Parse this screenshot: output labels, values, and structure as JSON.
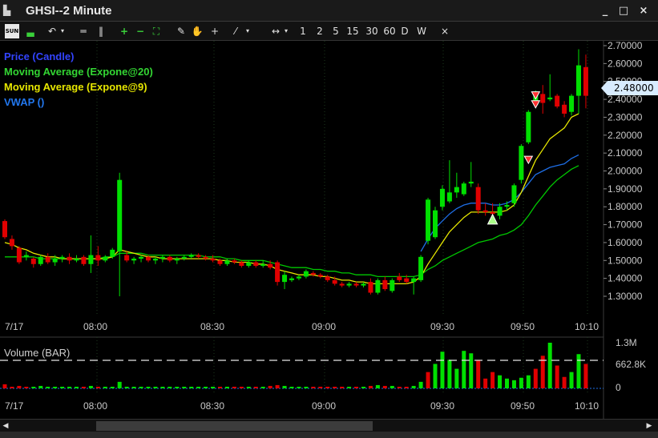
{
  "window": {
    "title": "GHSI--2 Minute",
    "minimize": "_",
    "maximize": "□",
    "close": "×"
  },
  "toolbar": {
    "sun_label": "SUN",
    "interval_1": "1",
    "interval_2": "2",
    "interval_5": "5",
    "interval_15": "15",
    "interval_30": "30",
    "interval_60": "60",
    "interval_d": "D",
    "interval_w": "W",
    "clear": "×"
  },
  "legend": {
    "price": "Price (Candle)",
    "ma20": "Moving Average (Expone@20)",
    "ma9": "Moving Average (Expone@9)",
    "vwap": "VWAP ()"
  },
  "price_tag": "2.48000",
  "volume": {
    "label": "Volume (BAR)",
    "ticks": [
      "1.3M",
      "662.8K",
      "0"
    ]
  },
  "colors": {
    "up": "#00e000",
    "down": "#e00000",
    "ma20": "#00c800",
    "ma9": "#e6e600",
    "vwap": "#1e6ee6",
    "grid": "#1e3a1e"
  },
  "chart_data": {
    "type": "candlestick",
    "y_ticks": [
      "2.70000",
      "2.60000",
      "2.50000",
      "2.40000",
      "2.30000",
      "2.20000",
      "2.10000",
      "2.00000",
      "1.90000",
      "1.80000",
      "1.70000",
      "1.60000",
      "1.50000",
      "1.40000",
      "1.30000"
    ],
    "x_ticks": [
      "7/17",
      "08:00",
      "08:30",
      "09:00",
      "09:30",
      "09:50",
      "10:10"
    ],
    "candles": [
      {
        "o": 1.72,
        "h": 1.73,
        "l": 1.62,
        "c": 1.63
      },
      {
        "o": 1.62,
        "h": 1.64,
        "l": 1.56,
        "c": 1.58
      },
      {
        "o": 1.57,
        "h": 1.58,
        "l": 1.48,
        "c": 1.49
      },
      {
        "o": 1.52,
        "h": 1.55,
        "l": 1.5,
        "c": 1.53
      },
      {
        "o": 1.51,
        "h": 1.52,
        "l": 1.46,
        "c": 1.48
      },
      {
        "o": 1.48,
        "h": 1.53,
        "l": 1.47,
        "c": 1.52
      },
      {
        "o": 1.52,
        "h": 1.54,
        "l": 1.48,
        "c": 1.49
      },
      {
        "o": 1.49,
        "h": 1.53,
        "l": 1.47,
        "c": 1.51
      },
      {
        "o": 1.51,
        "h": 1.53,
        "l": 1.49,
        "c": 1.52
      },
      {
        "o": 1.52,
        "h": 1.54,
        "l": 1.48,
        "c": 1.5
      },
      {
        "o": 1.5,
        "h": 1.53,
        "l": 1.49,
        "c": 1.51
      },
      {
        "o": 1.52,
        "h": 1.53,
        "l": 1.47,
        "c": 1.48
      },
      {
        "o": 1.48,
        "h": 1.64,
        "l": 1.43,
        "c": 1.53
      },
      {
        "o": 1.53,
        "h": 1.58,
        "l": 1.47,
        "c": 1.5
      },
      {
        "o": 1.5,
        "h": 1.53,
        "l": 1.49,
        "c": 1.52
      },
      {
        "o": 1.52,
        "h": 1.57,
        "l": 1.51,
        "c": 1.56
      },
      {
        "o": 1.55,
        "h": 1.99,
        "l": 1.3,
        "c": 1.95
      },
      {
        "o": 1.53,
        "h": 1.55,
        "l": 1.49,
        "c": 1.5
      },
      {
        "o": 1.5,
        "h": 1.52,
        "l": 1.48,
        "c": 1.51
      },
      {
        "o": 1.51,
        "h": 1.53,
        "l": 1.49,
        "c": 1.52
      },
      {
        "o": 1.52,
        "h": 1.53,
        "l": 1.49,
        "c": 1.5
      },
      {
        "o": 1.5,
        "h": 1.52,
        "l": 1.48,
        "c": 1.51
      },
      {
        "o": 1.51,
        "h": 1.53,
        "l": 1.49,
        "c": 1.52
      },
      {
        "o": 1.52,
        "h": 1.53,
        "l": 1.49,
        "c": 1.5
      },
      {
        "o": 1.5,
        "h": 1.52,
        "l": 1.48,
        "c": 1.51
      },
      {
        "o": 1.51,
        "h": 1.53,
        "l": 1.5,
        "c": 1.52
      },
      {
        "o": 1.52,
        "h": 1.54,
        "l": 1.51,
        "c": 1.53
      },
      {
        "o": 1.53,
        "h": 1.54,
        "l": 1.51,
        "c": 1.52
      },
      {
        "o": 1.52,
        "h": 1.53,
        "l": 1.5,
        "c": 1.51
      },
      {
        "o": 1.51,
        "h": 1.53,
        "l": 1.49,
        "c": 1.5
      },
      {
        "o": 1.5,
        "h": 1.51,
        "l": 1.47,
        "c": 1.48
      },
      {
        "o": 1.48,
        "h": 1.51,
        "l": 1.47,
        "c": 1.5
      },
      {
        "o": 1.5,
        "h": 1.51,
        "l": 1.48,
        "c": 1.49
      },
      {
        "o": 1.49,
        "h": 1.5,
        "l": 1.46,
        "c": 1.47
      },
      {
        "o": 1.47,
        "h": 1.5,
        "l": 1.46,
        "c": 1.49
      },
      {
        "o": 1.49,
        "h": 1.5,
        "l": 1.46,
        "c": 1.47
      },
      {
        "o": 1.47,
        "h": 1.5,
        "l": 1.46,
        "c": 1.48
      },
      {
        "o": 1.48,
        "h": 1.5,
        "l": 1.45,
        "c": 1.46
      },
      {
        "o": 1.49,
        "h": 1.5,
        "l": 1.36,
        "c": 1.38
      },
      {
        "o": 1.38,
        "h": 1.44,
        "l": 1.34,
        "c": 1.42
      },
      {
        "o": 1.39,
        "h": 1.41,
        "l": 1.38,
        "c": 1.4
      },
      {
        "o": 1.4,
        "h": 1.42,
        "l": 1.39,
        "c": 1.41
      },
      {
        "o": 1.41,
        "h": 1.45,
        "l": 1.4,
        "c": 1.44
      },
      {
        "o": 1.43,
        "h": 1.44,
        "l": 1.41,
        "c": 1.42
      },
      {
        "o": 1.42,
        "h": 1.43,
        "l": 1.4,
        "c": 1.41
      },
      {
        "o": 1.41,
        "h": 1.42,
        "l": 1.38,
        "c": 1.39
      },
      {
        "o": 1.39,
        "h": 1.41,
        "l": 1.36,
        "c": 1.37
      },
      {
        "o": 1.37,
        "h": 1.38,
        "l": 1.35,
        "c": 1.36
      },
      {
        "o": 1.36,
        "h": 1.38,
        "l": 1.35,
        "c": 1.37
      },
      {
        "o": 1.37,
        "h": 1.38,
        "l": 1.35,
        "c": 1.36
      },
      {
        "o": 1.36,
        "h": 1.38,
        "l": 1.35,
        "c": 1.37
      },
      {
        "o": 1.38,
        "h": 1.4,
        "l": 1.31,
        "c": 1.32
      },
      {
        "o": 1.32,
        "h": 1.4,
        "l": 1.31,
        "c": 1.39
      },
      {
        "o": 1.39,
        "h": 1.41,
        "l": 1.33,
        "c": 1.34
      },
      {
        "o": 1.33,
        "h": 1.4,
        "l": 1.32,
        "c": 1.39
      },
      {
        "o": 1.41,
        "h": 1.43,
        "l": 1.38,
        "c": 1.39
      },
      {
        "o": 1.4,
        "h": 1.42,
        "l": 1.37,
        "c": 1.38
      },
      {
        "o": 1.38,
        "h": 1.41,
        "l": 1.31,
        "c": 1.4
      },
      {
        "o": 1.39,
        "h": 1.53,
        "l": 1.38,
        "c": 1.52
      },
      {
        "o": 1.61,
        "h": 1.85,
        "l": 1.59,
        "c": 1.84
      },
      {
        "o": 1.63,
        "h": 1.8,
        "l": 1.62,
        "c": 1.78
      },
      {
        "o": 1.8,
        "h": 1.92,
        "l": 1.78,
        "c": 1.9
      },
      {
        "o": 1.83,
        "h": 2.06,
        "l": 1.82,
        "c": 1.88
      },
      {
        "o": 1.88,
        "h": 1.99,
        "l": 1.85,
        "c": 1.91
      },
      {
        "o": 1.87,
        "h": 1.94,
        "l": 1.86,
        "c": 1.93
      },
      {
        "o": 1.93,
        "h": 2.05,
        "l": 1.91,
        "c": 1.94
      },
      {
        "o": 1.91,
        "h": 1.93,
        "l": 1.76,
        "c": 1.78
      },
      {
        "o": 1.78,
        "h": 1.82,
        "l": 1.75,
        "c": 1.77
      },
      {
        "o": 1.77,
        "h": 1.82,
        "l": 1.75,
        "c": 1.76
      },
      {
        "o": 1.75,
        "h": 1.82,
        "l": 1.73,
        "c": 1.8
      },
      {
        "o": 1.8,
        "h": 1.83,
        "l": 1.78,
        "c": 1.81
      },
      {
        "o": 1.82,
        "h": 1.93,
        "l": 1.8,
        "c": 1.92
      },
      {
        "o": 1.95,
        "h": 2.15,
        "l": 1.93,
        "c": 2.14
      },
      {
        "o": 2.16,
        "h": 2.34,
        "l": 2.15,
        "c": 2.33
      },
      {
        "o": 2.37,
        "h": 2.45,
        "l": 2.35,
        "c": 2.43
      },
      {
        "o": 2.43,
        "h": 2.48,
        "l": 2.32,
        "c": 2.38
      },
      {
        "o": 2.4,
        "h": 2.54,
        "l": 2.39,
        "c": 2.41
      },
      {
        "o": 2.42,
        "h": 2.43,
        "l": 2.35,
        "c": 2.36
      },
      {
        "o": 2.37,
        "h": 2.39,
        "l": 2.3,
        "c": 2.32
      },
      {
        "o": 2.33,
        "h": 2.43,
        "l": 2.31,
        "c": 2.42
      },
      {
        "o": 2.42,
        "h": 2.68,
        "l": 2.32,
        "c": 2.59
      },
      {
        "o": 2.58,
        "h": 2.65,
        "l": 2.35,
        "c": 2.42
      }
    ],
    "ma20": [
      1.52,
      1.52,
      1.52,
      1.52,
      1.52,
      1.51,
      1.51,
      1.51,
      1.51,
      1.51,
      1.51,
      1.51,
      1.51,
      1.51,
      1.52,
      1.52,
      1.54,
      1.54,
      1.54,
      1.54,
      1.53,
      1.53,
      1.53,
      1.53,
      1.53,
      1.53,
      1.53,
      1.53,
      1.52,
      1.52,
      1.52,
      1.51,
      1.51,
      1.5,
      1.5,
      1.5,
      1.5,
      1.49,
      1.48,
      1.47,
      1.46,
      1.46,
      1.46,
      1.45,
      1.45,
      1.44,
      1.44,
      1.43,
      1.43,
      1.42,
      1.42,
      1.42,
      1.41,
      1.41,
      1.41,
      1.41,
      1.41,
      1.41,
      1.42,
      1.45,
      1.47,
      1.5,
      1.52,
      1.54,
      1.56,
      1.58,
      1.6,
      1.61,
      1.62,
      1.64,
      1.65,
      1.67,
      1.7,
      1.75,
      1.81,
      1.86,
      1.91,
      1.95,
      1.98,
      2.01,
      2.03
    ],
    "ma9": [
      1.6,
      1.59,
      1.57,
      1.56,
      1.54,
      1.53,
      1.52,
      1.52,
      1.51,
      1.51,
      1.51,
      1.51,
      1.51,
      1.51,
      1.51,
      1.52,
      1.56,
      1.55,
      1.54,
      1.53,
      1.52,
      1.52,
      1.51,
      1.51,
      1.51,
      1.51,
      1.51,
      1.51,
      1.51,
      1.51,
      1.5,
      1.5,
      1.49,
      1.49,
      1.49,
      1.48,
      1.48,
      1.47,
      1.45,
      1.44,
      1.43,
      1.42,
      1.42,
      1.42,
      1.41,
      1.41,
      1.4,
      1.39,
      1.39,
      1.38,
      1.38,
      1.37,
      1.37,
      1.37,
      1.37,
      1.37,
      1.37,
      1.38,
      1.41,
      1.48,
      1.54,
      1.6,
      1.66,
      1.7,
      1.74,
      1.77,
      1.77,
      1.77,
      1.77,
      1.77,
      1.78,
      1.81,
      1.88,
      1.97,
      2.06,
      2.12,
      2.18,
      2.21,
      2.24,
      2.3,
      2.32
    ],
    "vwap": [
      null,
      null,
      null,
      null,
      null,
      null,
      null,
      null,
      null,
      null,
      null,
      null,
      null,
      null,
      null,
      null,
      null,
      null,
      null,
      null,
      null,
      null,
      null,
      null,
      null,
      null,
      null,
      null,
      null,
      null,
      null,
      null,
      null,
      null,
      null,
      null,
      null,
      null,
      null,
      null,
      null,
      null,
      null,
      null,
      null,
      null,
      null,
      null,
      null,
      null,
      null,
      null,
      null,
      null,
      null,
      null,
      null,
      null,
      1.55,
      1.62,
      1.68,
      1.72,
      1.76,
      1.79,
      1.81,
      1.82,
      1.82,
      1.82,
      1.81,
      1.81,
      1.82,
      1.84,
      1.88,
      1.93,
      1.98,
      2.0,
      2.02,
      2.03,
      2.04,
      2.07,
      2.09
    ],
    "volumes": [
      5,
      2,
      3,
      2,
      2,
      3,
      2,
      2,
      2,
      2,
      2,
      2,
      3,
      2,
      2,
      2,
      8,
      2,
      2,
      2,
      2,
      2,
      2,
      2,
      2,
      2,
      2,
      2,
      2,
      2,
      2,
      2,
      2,
      2,
      2,
      2,
      2,
      3,
      4,
      3,
      2,
      2,
      2,
      2,
      2,
      2,
      2,
      2,
      2,
      2,
      2,
      3,
      4,
      3,
      3,
      2,
      2,
      3,
      8,
      20,
      30,
      45,
      35,
      24,
      46,
      43,
      35,
      12,
      20,
      16,
      12,
      10,
      13,
      16,
      24,
      40,
      56,
      28,
      14,
      20,
      42,
      30
    ],
    "volume_colors": [
      "d",
      "d",
      "d",
      "d",
      "u",
      "u",
      "u",
      "u",
      "u",
      "u",
      "u",
      "d",
      "u",
      "d",
      "u",
      "u",
      "u",
      "u",
      "u",
      "u",
      "u",
      "u",
      "u",
      "u",
      "u",
      "u",
      "u",
      "u",
      "u",
      "u",
      "d",
      "u",
      "d",
      "d",
      "u",
      "d",
      "u",
      "d",
      "d",
      "u",
      "u",
      "u",
      "u",
      "d",
      "d",
      "d",
      "d",
      "d",
      "u",
      "d",
      "u",
      "d",
      "u",
      "d",
      "u",
      "d",
      "d",
      "u",
      "u",
      "d",
      "u",
      "u",
      "u",
      "u",
      "u",
      "u",
      "d",
      "d",
      "d",
      "u",
      "u",
      "u",
      "u",
      "u",
      "d",
      "d",
      "u",
      "d",
      "d",
      "u",
      "u",
      "d"
    ],
    "markers": [
      {
        "type": "down",
        "index": 73,
        "value": 2.06
      },
      {
        "type": "down",
        "index": 74,
        "value": 2.42
      },
      {
        "type": "down",
        "index": 74,
        "value": 2.37
      },
      {
        "type": "up",
        "index": 68,
        "value": 1.73
      }
    ]
  }
}
